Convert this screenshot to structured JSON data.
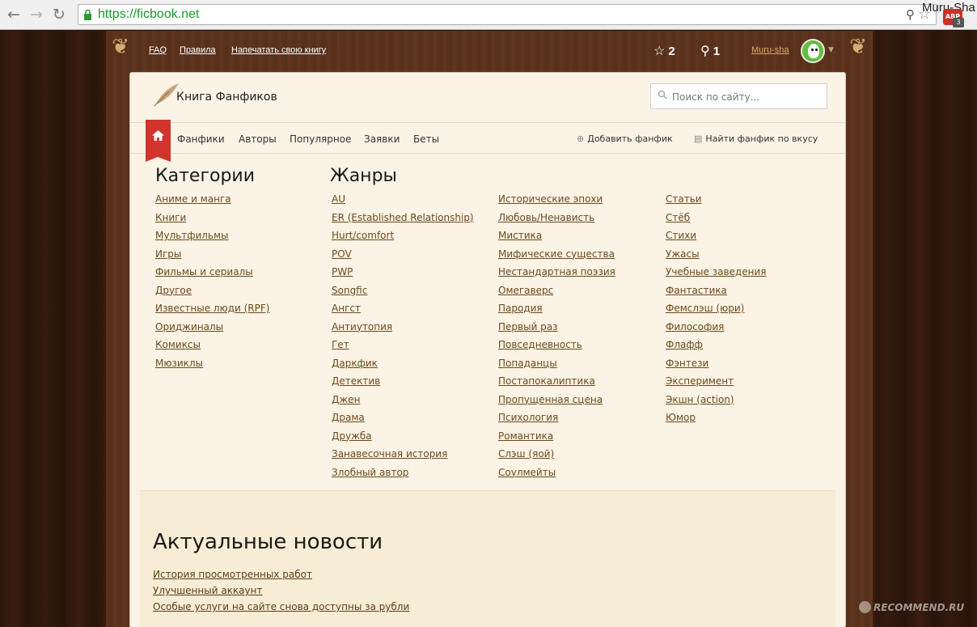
{
  "browser": {
    "url": "https://ficbook.net",
    "profile": "Muru-Sha",
    "abp_label": "ABP",
    "abp_badge": "3"
  },
  "topbar": {
    "links": [
      "FAQ",
      "Правила",
      "Напечатать свою книгу"
    ],
    "stars": "2",
    "ideas": "1",
    "username": "Muru-sha"
  },
  "header": {
    "logo_text": "Книга Фанфиков",
    "search_placeholder": "Поиск по сайту..."
  },
  "nav": {
    "items": [
      "Фанфики",
      "Авторы",
      "Популярное",
      "Заявки",
      "Беты"
    ],
    "add_fanfic": "Добавить фанфик",
    "find_fanfic": "Найти фанфик по вкусу"
  },
  "categories": {
    "title": "Категории",
    "items": [
      "Аниме и манга",
      "Книги",
      "Мультфильмы",
      "Игры",
      "Фильмы и сериалы",
      "Другое",
      "Известные люди (RPF)",
      "Ориджиналы",
      "Комиксы",
      "Мюзиклы"
    ]
  },
  "genres": {
    "title": "Жанры",
    "col1": [
      "AU",
      "ER (Established Relationship)",
      "Hurt/comfort",
      "POV",
      "PWP",
      "Songfic",
      "Ангст",
      "Антиутопия",
      "Гет",
      "Даркфик",
      "Детектив",
      "Джен",
      "Драма",
      "Дружба",
      "Занавесочная история",
      "Злобный автор"
    ],
    "col2": [
      "Исторические эпохи",
      "Любовь/Ненависть",
      "Мистика",
      "Мифические существа",
      "Нестандартная поэзия",
      "Омегаверс",
      "Пародия",
      "Первый раз",
      "Повседневность",
      "Попаданцы",
      "Постапокалиптика",
      "Пропущенная сцена",
      "Психология",
      "Романтика",
      "Слэш (яой)",
      "Соулмейты"
    ],
    "col3": [
      "Статьи",
      "Стёб",
      "Стихи",
      "Ужасы",
      "Учебные заведения",
      "Фантастика",
      "Фемслэш (юри)",
      "Философия",
      "Флафф",
      "Фэнтези",
      "Эксперимент",
      "Экшн (action)",
      "Юмор"
    ]
  },
  "news": {
    "title": "Актуальные новости",
    "items": [
      "История просмотренных работ",
      "Улучшенный аккаунт",
      "Особые услуги на сайте снова доступны за рубли"
    ]
  },
  "watermark": "RECOMMEND.RU",
  "colors": {
    "link": "#6c4a1c",
    "home_red": "#d2342d",
    "parchment": "#fbf3e5",
    "wood": "#5b301b"
  }
}
